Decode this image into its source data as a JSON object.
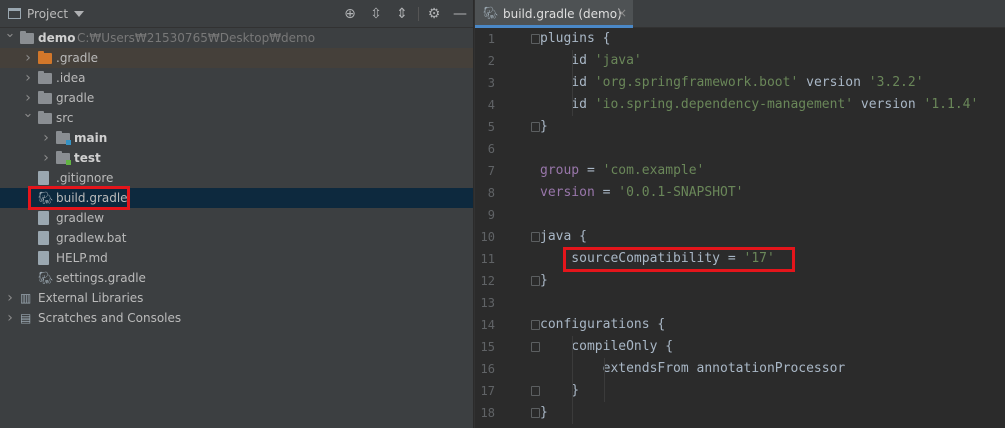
{
  "project_panel": {
    "title": "Project",
    "toolbar": {
      "locate_icon": "crosshair-icon",
      "expand_icon": "expand-all-icon",
      "collapse_icon": "collapse-all-icon",
      "settings_icon": "gear-icon",
      "hide_icon": "minus-icon"
    },
    "tree": [
      {
        "label": "demo",
        "path": "C:₩Users₩21530765₩Desktop₩demo",
        "depth": 0,
        "kind": "folder",
        "expanded": true
      },
      {
        "label": ".gradle",
        "depth": 1,
        "kind": "folder-orange",
        "expanded": false
      },
      {
        "label": ".idea",
        "depth": 1,
        "kind": "folder",
        "expanded": false
      },
      {
        "label": "gradle",
        "depth": 1,
        "kind": "folder",
        "expanded": false
      },
      {
        "label": "src",
        "depth": 1,
        "kind": "folder",
        "expanded": true
      },
      {
        "label": "main",
        "depth": 2,
        "kind": "folder-src-main",
        "expanded": false
      },
      {
        "label": "test",
        "depth": 2,
        "kind": "folder-src-test",
        "expanded": false
      },
      {
        "label": ".gitignore",
        "depth": 1,
        "kind": "file"
      },
      {
        "label": "build.gradle",
        "depth": 1,
        "kind": "gradle",
        "selected": true
      },
      {
        "label": "gradlew",
        "depth": 1,
        "kind": "file"
      },
      {
        "label": "gradlew.bat",
        "depth": 1,
        "kind": "file"
      },
      {
        "label": "HELP.md",
        "depth": 1,
        "kind": "file"
      },
      {
        "label": "settings.gradle",
        "depth": 1,
        "kind": "gradle"
      },
      {
        "label": "External Libraries",
        "depth": 0,
        "kind": "library",
        "expanded": false
      },
      {
        "label": "Scratches and Consoles",
        "depth": 0,
        "kind": "scratch",
        "expanded": false
      }
    ]
  },
  "editor": {
    "tab_label": "build.gradle (demo)",
    "tab_close": "×",
    "lines": [
      {
        "n": "1",
        "text": "plugins {"
      },
      {
        "n": "2",
        "text": "    id 'java'"
      },
      {
        "n": "3",
        "text": "    id 'org.springframework.boot' version '3.2.2'"
      },
      {
        "n": "4",
        "text": "    id 'io.spring.dependency-management' version '1.1.4'"
      },
      {
        "n": "5",
        "text": "}"
      },
      {
        "n": "6",
        "text": ""
      },
      {
        "n": "7",
        "text": "group = 'com.example'"
      },
      {
        "n": "8",
        "text": "version = '0.0.1-SNAPSHOT'"
      },
      {
        "n": "9",
        "text": ""
      },
      {
        "n": "10",
        "text": "java {"
      },
      {
        "n": "11",
        "text": "    sourceCompatibility = '17'"
      },
      {
        "n": "12",
        "text": "}"
      },
      {
        "n": "13",
        "text": ""
      },
      {
        "n": "14",
        "text": "configurations {"
      },
      {
        "n": "15",
        "text": "    compileOnly {"
      },
      {
        "n": "16",
        "text": "        extendsFrom annotationProcessor"
      },
      {
        "n": "17",
        "text": "    }"
      },
      {
        "n": "18",
        "text": "}"
      }
    ]
  },
  "colors": {
    "highlight_box": "#e4151b",
    "selection": "#0d293e",
    "string": "#6a8759",
    "property": "#9876aa",
    "text": "#a9b7c6"
  }
}
